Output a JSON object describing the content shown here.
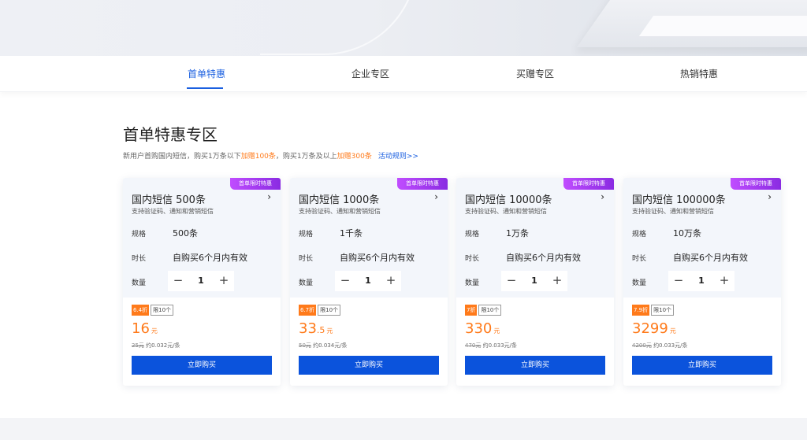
{
  "tabs": [
    {
      "label": "首单特惠",
      "active": true
    },
    {
      "label": "企业专区",
      "active": false
    },
    {
      "label": "买赠专区",
      "active": false
    },
    {
      "label": "热销特惠",
      "active": false
    }
  ],
  "section": {
    "title": "首单特惠专区",
    "desc_part1": "新用户首购国内短信，购买1万条以下",
    "desc_hl1": "加赠100条",
    "desc_part2": "，购买1万条及以上",
    "desc_hl2": "加赠300条",
    "rules_link": "活动规则>>"
  },
  "common": {
    "ribbon": "首单限时特惠",
    "subtitle": "支持验证码、通知和营销短信",
    "spec_label": "规格",
    "duration_label": "时长",
    "duration_value": "自购买6个月内有效",
    "qty_label": "数量",
    "qty": "1",
    "minus": "−",
    "plus": "+",
    "chevron": "›",
    "limit": "限10个",
    "yuan": "元",
    "buy_label": "立即购买"
  },
  "cards": [
    {
      "name": "国内短信 500条",
      "spec": "500条",
      "discount": "6.4折",
      "price_int": "16",
      "price_dec": "",
      "orig_price": "25元",
      "unit_price": "约0.032元/条"
    },
    {
      "name": "国内短信 1000条",
      "spec": "1千条",
      "discount": "6.7折",
      "price_int": "33",
      "price_dec": ".5",
      "orig_price": "50元",
      "unit_price": "约0.034元/条"
    },
    {
      "name": "国内短信 10000条",
      "spec": "1万条",
      "discount": "7折",
      "price_int": "330",
      "price_dec": "",
      "orig_price": "470元",
      "unit_price": "约0.033元/条"
    },
    {
      "name": "国内短信 100000条",
      "spec": "10万条",
      "discount": "7.9折",
      "price_int": "3299",
      "price_dec": "",
      "orig_price": "4200元",
      "unit_price": "约0.033元/条"
    }
  ]
}
